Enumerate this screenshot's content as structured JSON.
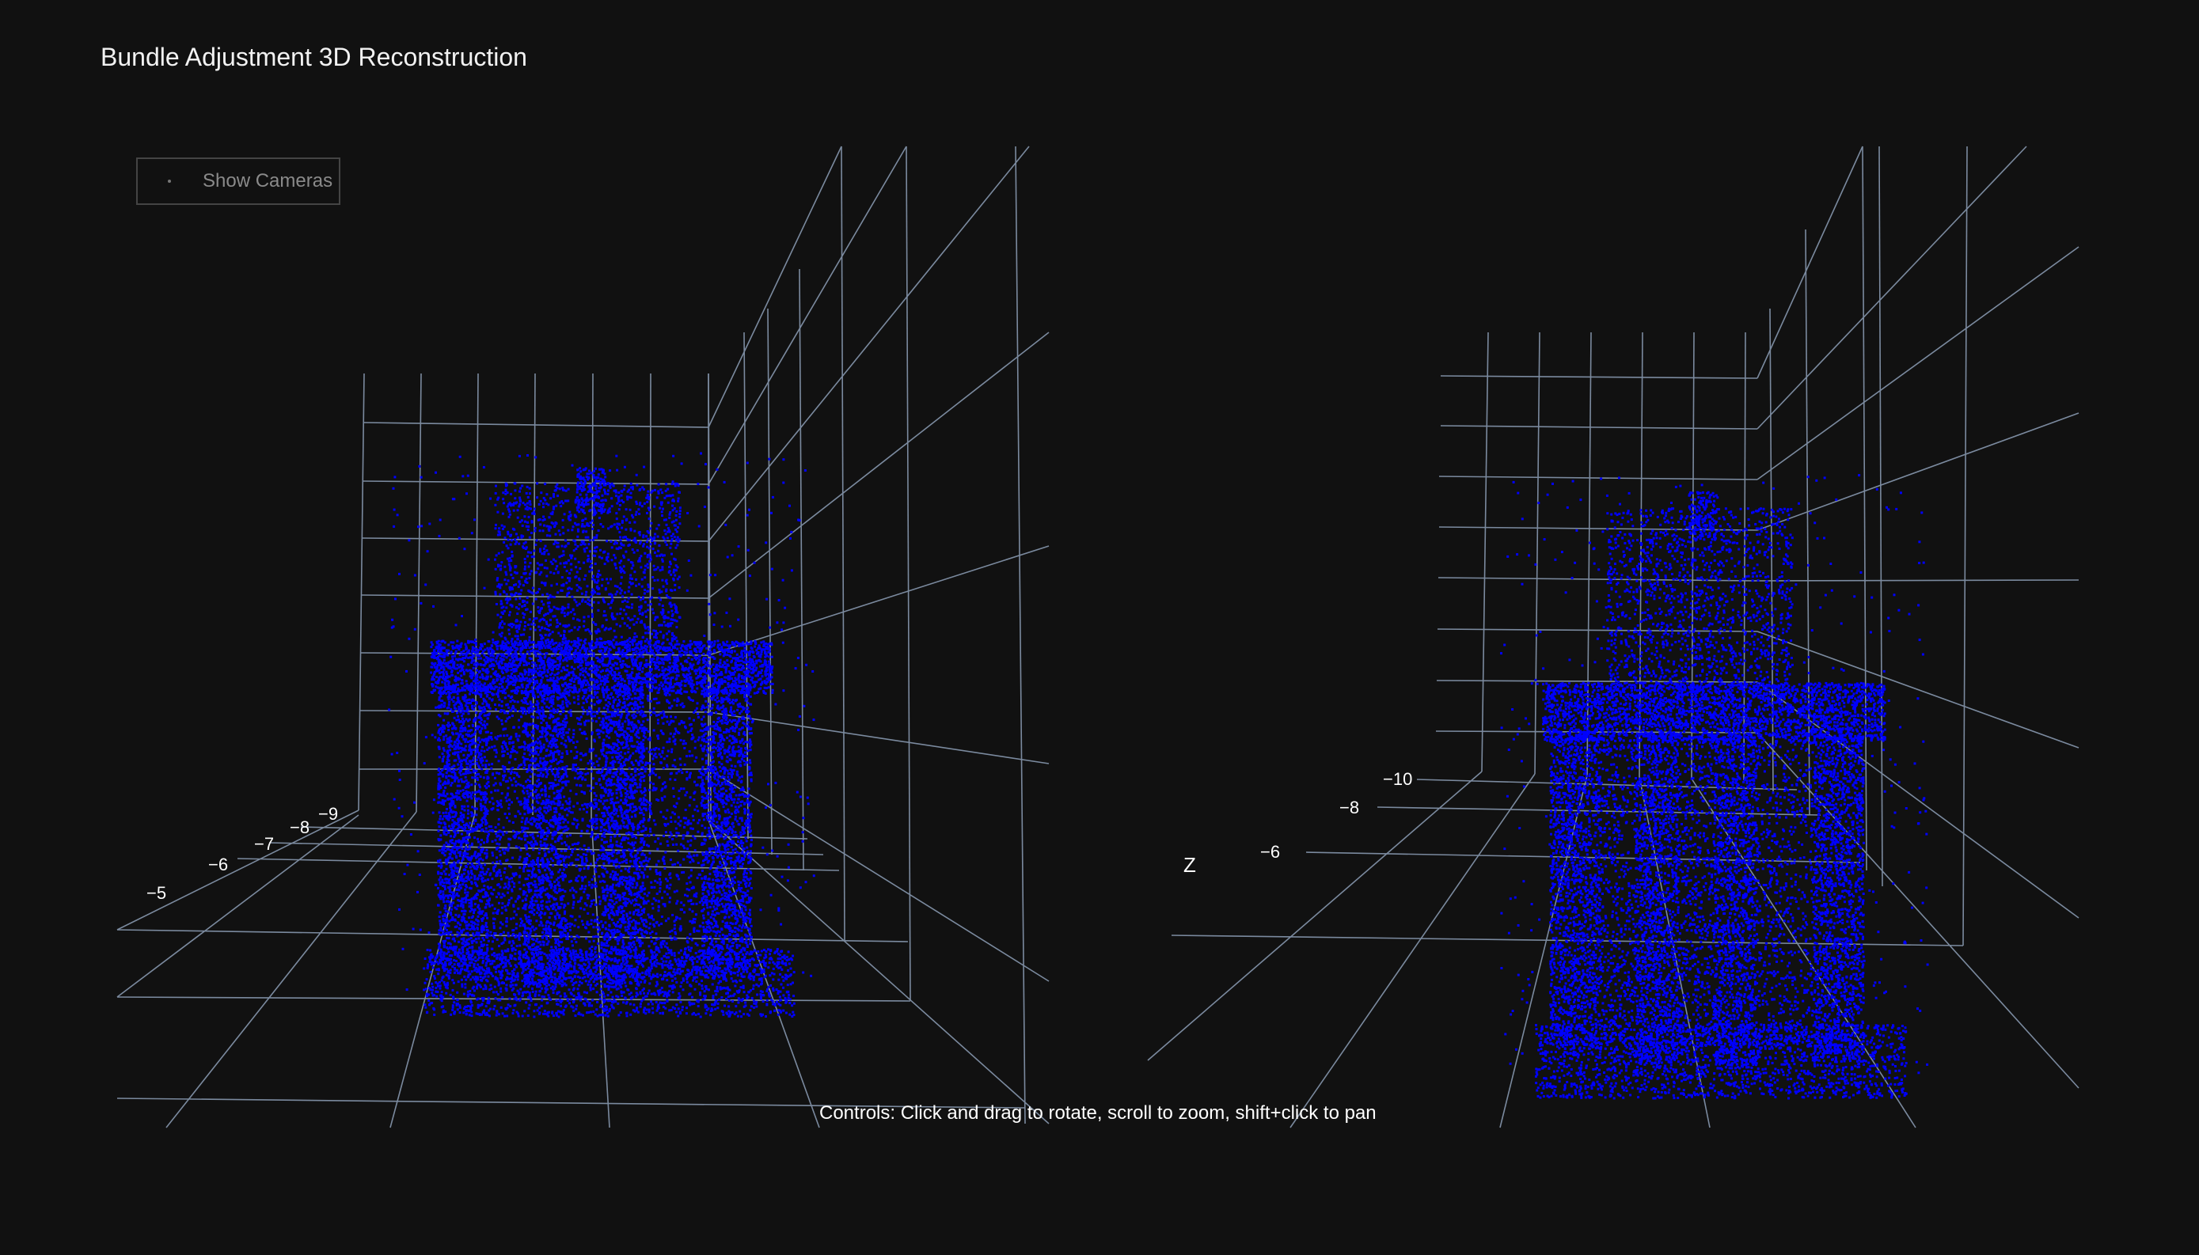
{
  "title": "Bundle Adjustment 3D Reconstruction",
  "legend": {
    "label": "Show Cameras",
    "marker_color": "#777777"
  },
  "controls_hint": "Controls: Click and drag to rotate, scroll to zoom, shift+click to pan",
  "colors": {
    "background": "#111111",
    "grid": "#8ea0b8",
    "points": "#0000ff",
    "text": "#ffffff"
  },
  "views": [
    {
      "name": "left-view",
      "axis_ticks": [
        "−9",
        "−8",
        "−7",
        "−6",
        "−5"
      ]
    },
    {
      "name": "right-view",
      "axis_ticks": [
        "−10",
        "−8",
        "−6"
      ],
      "axis_title": "Z"
    }
  ]
}
